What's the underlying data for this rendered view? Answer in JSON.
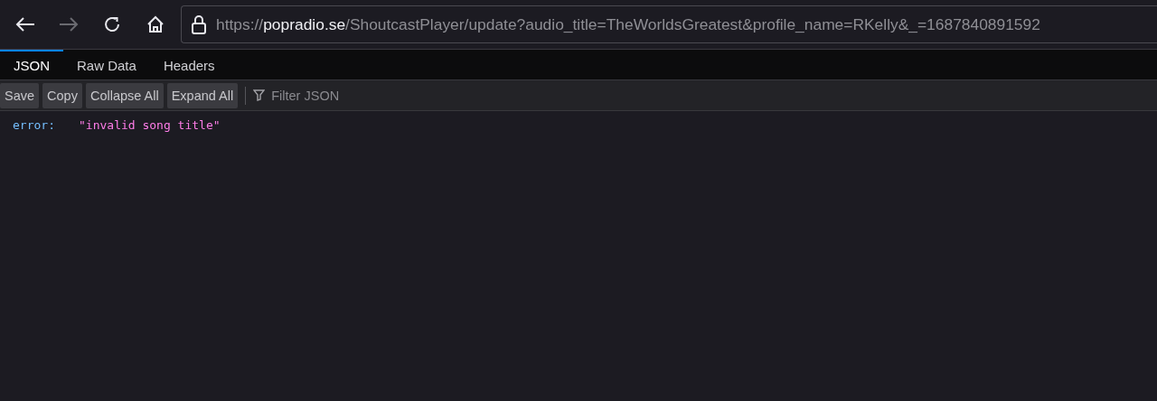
{
  "navigation": {
    "back_disabled": false,
    "forward_disabled": true
  },
  "address_bar": {
    "scheme": "https://",
    "host": "popradio.se",
    "path": "/ShoutcastPlayer/update?audio_title=TheWorldsGreatest&profile_name=RKelly&_=1687840891592"
  },
  "tabs": [
    {
      "label": "JSON",
      "selected": true
    },
    {
      "label": "Raw Data",
      "selected": false
    },
    {
      "label": "Headers",
      "selected": false
    }
  ],
  "toolbar": {
    "buttons": [
      "Save",
      "Copy",
      "Collapse All",
      "Expand All"
    ],
    "filter": {
      "placeholder": "Filter JSON"
    }
  },
  "json": [
    {
      "key": "error:",
      "value": "\"invalid song title\""
    }
  ]
}
